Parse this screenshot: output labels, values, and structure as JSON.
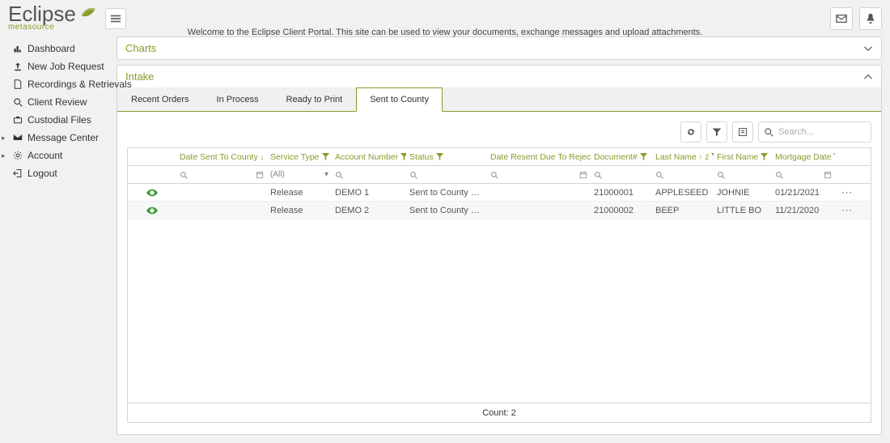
{
  "brand": {
    "name": "Eclipse",
    "sub": "metasource"
  },
  "welcome_text": "Welcome to the Eclipse Client Portal. This site can be used to view your documents, exchange messages and upload attachments.",
  "sidebar": [
    {
      "label": "Dashboard"
    },
    {
      "label": "New Job Request"
    },
    {
      "label": "Recordings & Retrievals"
    },
    {
      "label": "Client Review"
    },
    {
      "label": "Custodial Files"
    },
    {
      "label": "Message Center",
      "expander": true
    },
    {
      "label": "Account",
      "expander": true
    },
    {
      "label": "Logout"
    }
  ],
  "panels": {
    "charts_title": "Charts",
    "intake_title": "Intake"
  },
  "tabs": [
    {
      "label": "Recent Orders"
    },
    {
      "label": "In Process"
    },
    {
      "label": "Ready to Print"
    },
    {
      "label": "Sent to County",
      "active": true
    }
  ],
  "search": {
    "placeholder": "Search..."
  },
  "columns": [
    {
      "label": "",
      "key": "view"
    },
    {
      "label": "Date Sent To County",
      "sort": "1"
    },
    {
      "label": "Service Type"
    },
    {
      "label": "Account Number"
    },
    {
      "label": "Status"
    },
    {
      "label": "Date Resent Due To Reject"
    },
    {
      "label": "Document#"
    },
    {
      "label": "Last Name",
      "sort": "2"
    },
    {
      "label": "First Name"
    },
    {
      "label": "Mortgage Date"
    },
    {
      "label": "",
      "key": "actions"
    }
  ],
  "filter_all_label": "(All)",
  "rows": [
    {
      "service_type": "Release",
      "account": "DEMO 1",
      "status": "Sent to County Recorder",
      "document": "21000001",
      "last": "APPLESEED",
      "first": "JOHNIE",
      "mortgage": "01/21/2021"
    },
    {
      "service_type": "Release",
      "account": "DEMO 2",
      "status": "Sent to County Recorder",
      "document": "21000002",
      "last": "BEEP",
      "first": "LITTLE BO",
      "mortgage": "11/21/2020"
    }
  ],
  "footer": {
    "count_label": "Count:",
    "count_value": "2"
  }
}
